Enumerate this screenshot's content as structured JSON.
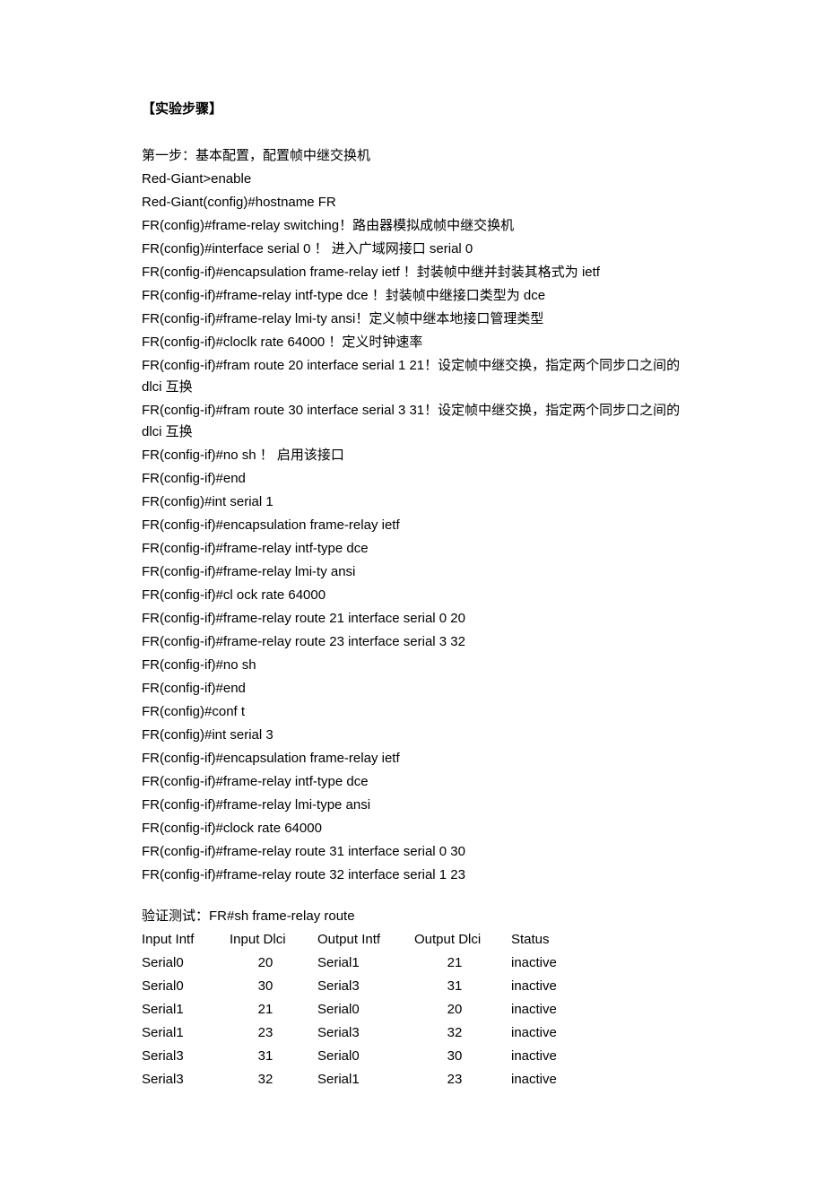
{
  "section_heading": "【实验步骤】",
  "step1_title": "第一步：基本配置，配置帧中继交换机",
  "lines": [
    "Red-Giant>enable",
    "Red-Giant(config)#hostname FR",
    "FR(config)#frame-relay switching！路由器模拟成帧中继交换机",
    "FR(config)#interface serial 0  ！  进入广域网接口 serial 0",
    "FR(config-if)#encapsulation frame-relay ietf   ！封装帧中继并封装其格式为 ietf",
    "FR(config-if)#frame-relay intf-type dce  ！封装帧中继接口类型为 dce",
    "FR(config-if)#frame-relay lmi-ty ansi！定义帧中继本地接口管理类型",
    "FR(config-if)#cloclk rate 64000  ！定义时钟速率",
    "FR(config-if)#fram route 20 interface serial 1 21！设定帧中继交换，指定两个同步口之间的dlci 互换",
    "FR(config-if)#fram route 30 interface serial 3 31！设定帧中继交换，指定两个同步口之间的dlci 互换",
    "FR(config-if)#no sh  ！   启用该接口",
    "FR(config-if)#end",
    "FR(config)#int serial 1",
    "FR(config-if)#encapsulation frame-relay ietf",
    "FR(config-if)#frame-relay intf-type dce",
    "FR(config-if)#frame-relay lmi-ty ansi",
    "FR(config-if)#cl ock rate 64000",
    "FR(config-if)#frame-relay route 21 interface serial 0 20",
    "FR(config-if)#frame-relay route 23 interface serial 3 32",
    "FR(config-if)#no sh",
    "FR(config-if)#end",
    "FR(config)#conf t",
    "FR(config)#int serial 3",
    "FR(config-if)#encapsulation frame-relay ietf",
    "FR(config-if)#frame-relay intf-type dce",
    "FR(config-if)#frame-relay lmi-type ansi",
    "FR(config-if)#clock rate 64000",
    "FR(config-if)#frame-relay route 31 interface serial 0 30",
    "FR(config-if)#frame-relay route 32 interface serial 1 23"
  ],
  "verify_title": "验证测试：FR#sh frame-relay route",
  "table": {
    "headers": [
      "Input Intf",
      "Input Dlci",
      "Output Intf",
      "Output Dlci",
      "Status"
    ],
    "rows": [
      [
        "Serial0",
        "20",
        "Serial1",
        "21",
        "inactive"
      ],
      [
        "Serial0",
        "30",
        "Serial3",
        "31",
        "inactive"
      ],
      [
        "Serial1",
        "21",
        "Serial0",
        "20",
        "inactive"
      ],
      [
        "Serial1",
        "23",
        "Serial3",
        "32",
        "inactive"
      ],
      [
        "Serial3",
        "31",
        "Serial0",
        "30",
        "inactive"
      ],
      [
        "Serial3",
        "32",
        "Serial1",
        "23",
        "inactive"
      ]
    ]
  }
}
